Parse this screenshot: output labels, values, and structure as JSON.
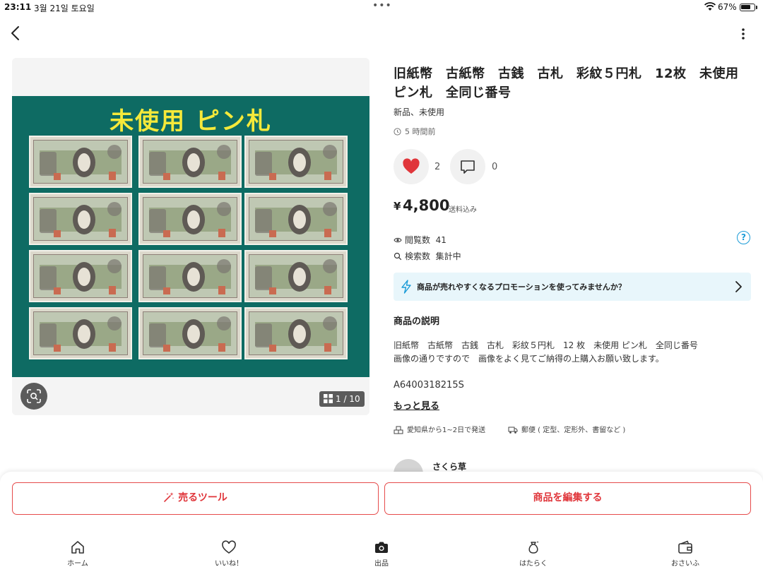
{
  "status_bar": {
    "time": "23:11",
    "date": "3월 21일 토요일",
    "battery": "67%"
  },
  "photo": {
    "overlay_text": "未使用 ピン札",
    "page_indicator": "1 / 10"
  },
  "item": {
    "title": "旧紙幣　古紙幣　古銭　古札　彩紋５円札　12枚　未使用　ピン札　全同じ番号",
    "condition": "新品、未使用",
    "posted": "5 時間前",
    "likes": "2",
    "comments": "0",
    "price_symbol": "¥",
    "price": "4,800",
    "shipping_note": "送料込み",
    "views_label": "閲覧数",
    "views_value": "41",
    "search_label": "検索数",
    "search_value": "集計中"
  },
  "promo": {
    "text": "商品が売れやすくなるプロモーションを使ってみませんか？"
  },
  "description": {
    "heading": "商品の説明",
    "line1": "旧紙幣　古紙幣　古銭　古札　彩紋５円札　12 枚　未使用 ピン札　全同じ番号",
    "line2": "画像の通りですので　画像をよく見てご納得の上購入お願い致します。",
    "code": "A6400318215S",
    "more": "もっと見る"
  },
  "shipping": {
    "origin": "愛知県から1~2日で発送",
    "method": "郵便 ( 定型、定形外、書留など )"
  },
  "seller": {
    "name": "さくら草"
  },
  "actions": {
    "sell_tool": "売るツール",
    "edit_item": "商品を編集する"
  },
  "tabs": [
    {
      "label": "ホーム",
      "icon": "home-icon"
    },
    {
      "label": "いいね！",
      "icon": "heart-outline-icon"
    },
    {
      "label": "出品",
      "icon": "camera-icon"
    },
    {
      "label": "はたらく",
      "icon": "money-bag-icon"
    },
    {
      "label": "おさいふ",
      "icon": "wallet-icon"
    }
  ],
  "colors": {
    "accent_red": "#e0363b",
    "heart_red": "#e0363b",
    "promo_bg": "#e8f6fb",
    "help_blue": "#1a9bd7",
    "photo_bg": "#0e6b63",
    "photo_text": "#f5e93a"
  }
}
